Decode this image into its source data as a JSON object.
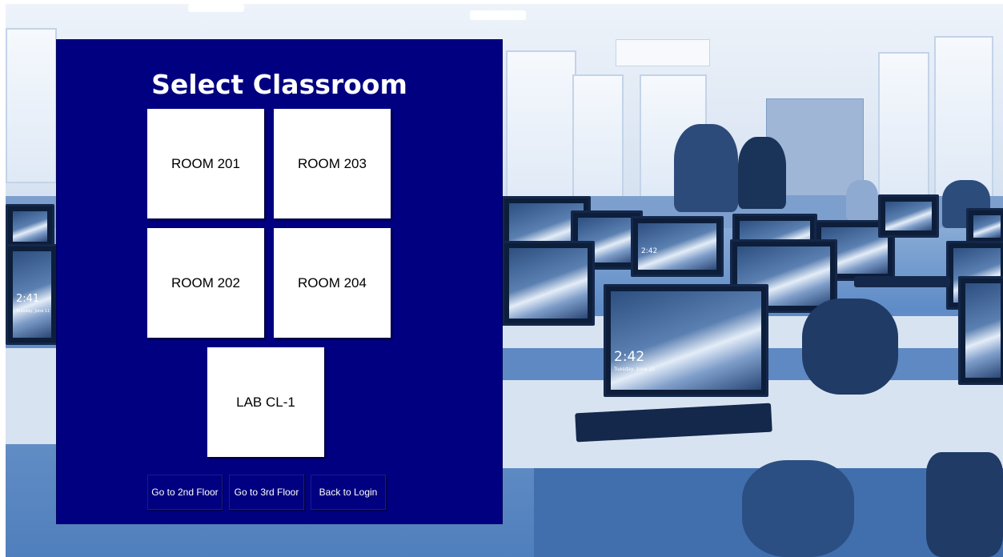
{
  "screen": {
    "title": "Select Classroom",
    "rooms": [
      {
        "label": "ROOM 201"
      },
      {
        "label": "ROOM 203"
      },
      {
        "label": "ROOM 202"
      },
      {
        "label": "ROOM 204"
      },
      {
        "label": "LAB CL-1"
      }
    ],
    "nav": {
      "floor2": "Go to 2nd Floor",
      "floor3": "Go to 3rd Floor",
      "back": "Back to Login"
    }
  },
  "background": {
    "monitor_times": [
      "2:41",
      "2:42",
      "2:42"
    ],
    "monitor_dates": [
      "Tuesday, June 11",
      "Tuesday, June 11"
    ]
  },
  "colors": {
    "panel": "#000080",
    "button": "#ffffff",
    "title_text": "#ffffff"
  }
}
